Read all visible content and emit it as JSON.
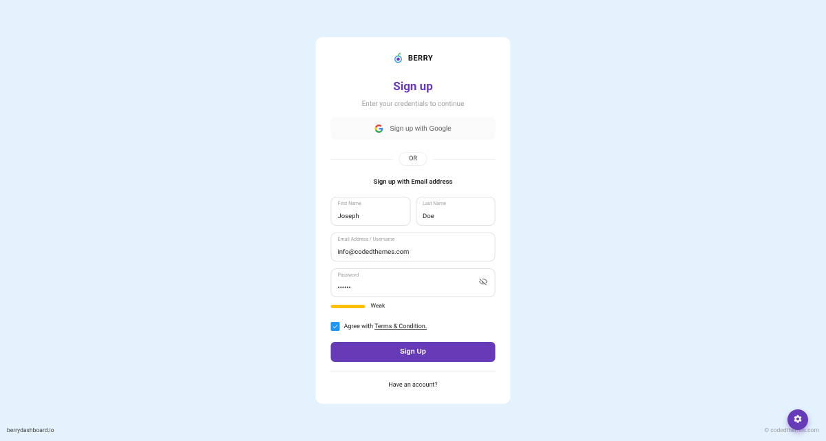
{
  "brand": {
    "name": "BERRY"
  },
  "signup": {
    "title": "Sign up",
    "subtitle": "Enter your credentials to continue",
    "google_label": "Sign up with Google",
    "or_label": "OR",
    "email_heading": "Sign up with Email address",
    "first_name_label": "First Name",
    "first_name_value": "Joseph",
    "last_name_label": "Last Name",
    "last_name_value": "Doe",
    "email_label": "Email Address / Username",
    "email_value": "info@codedthemes.com",
    "password_label": "Password",
    "password_value": "••••••",
    "strength_label": "Weak",
    "strength_color": "#ffc107",
    "terms_prefix": "Agree with ",
    "terms_link": "Terms & Condition.",
    "terms_checked": true,
    "submit_label": "Sign Up",
    "have_account": "Have an account?"
  },
  "footer": {
    "left": "berrydashboard.io",
    "right": "© codedthemes.com"
  },
  "colors": {
    "primary": "#673ab7",
    "background": "#e3f2fd",
    "checkbox": "#2196f3"
  }
}
